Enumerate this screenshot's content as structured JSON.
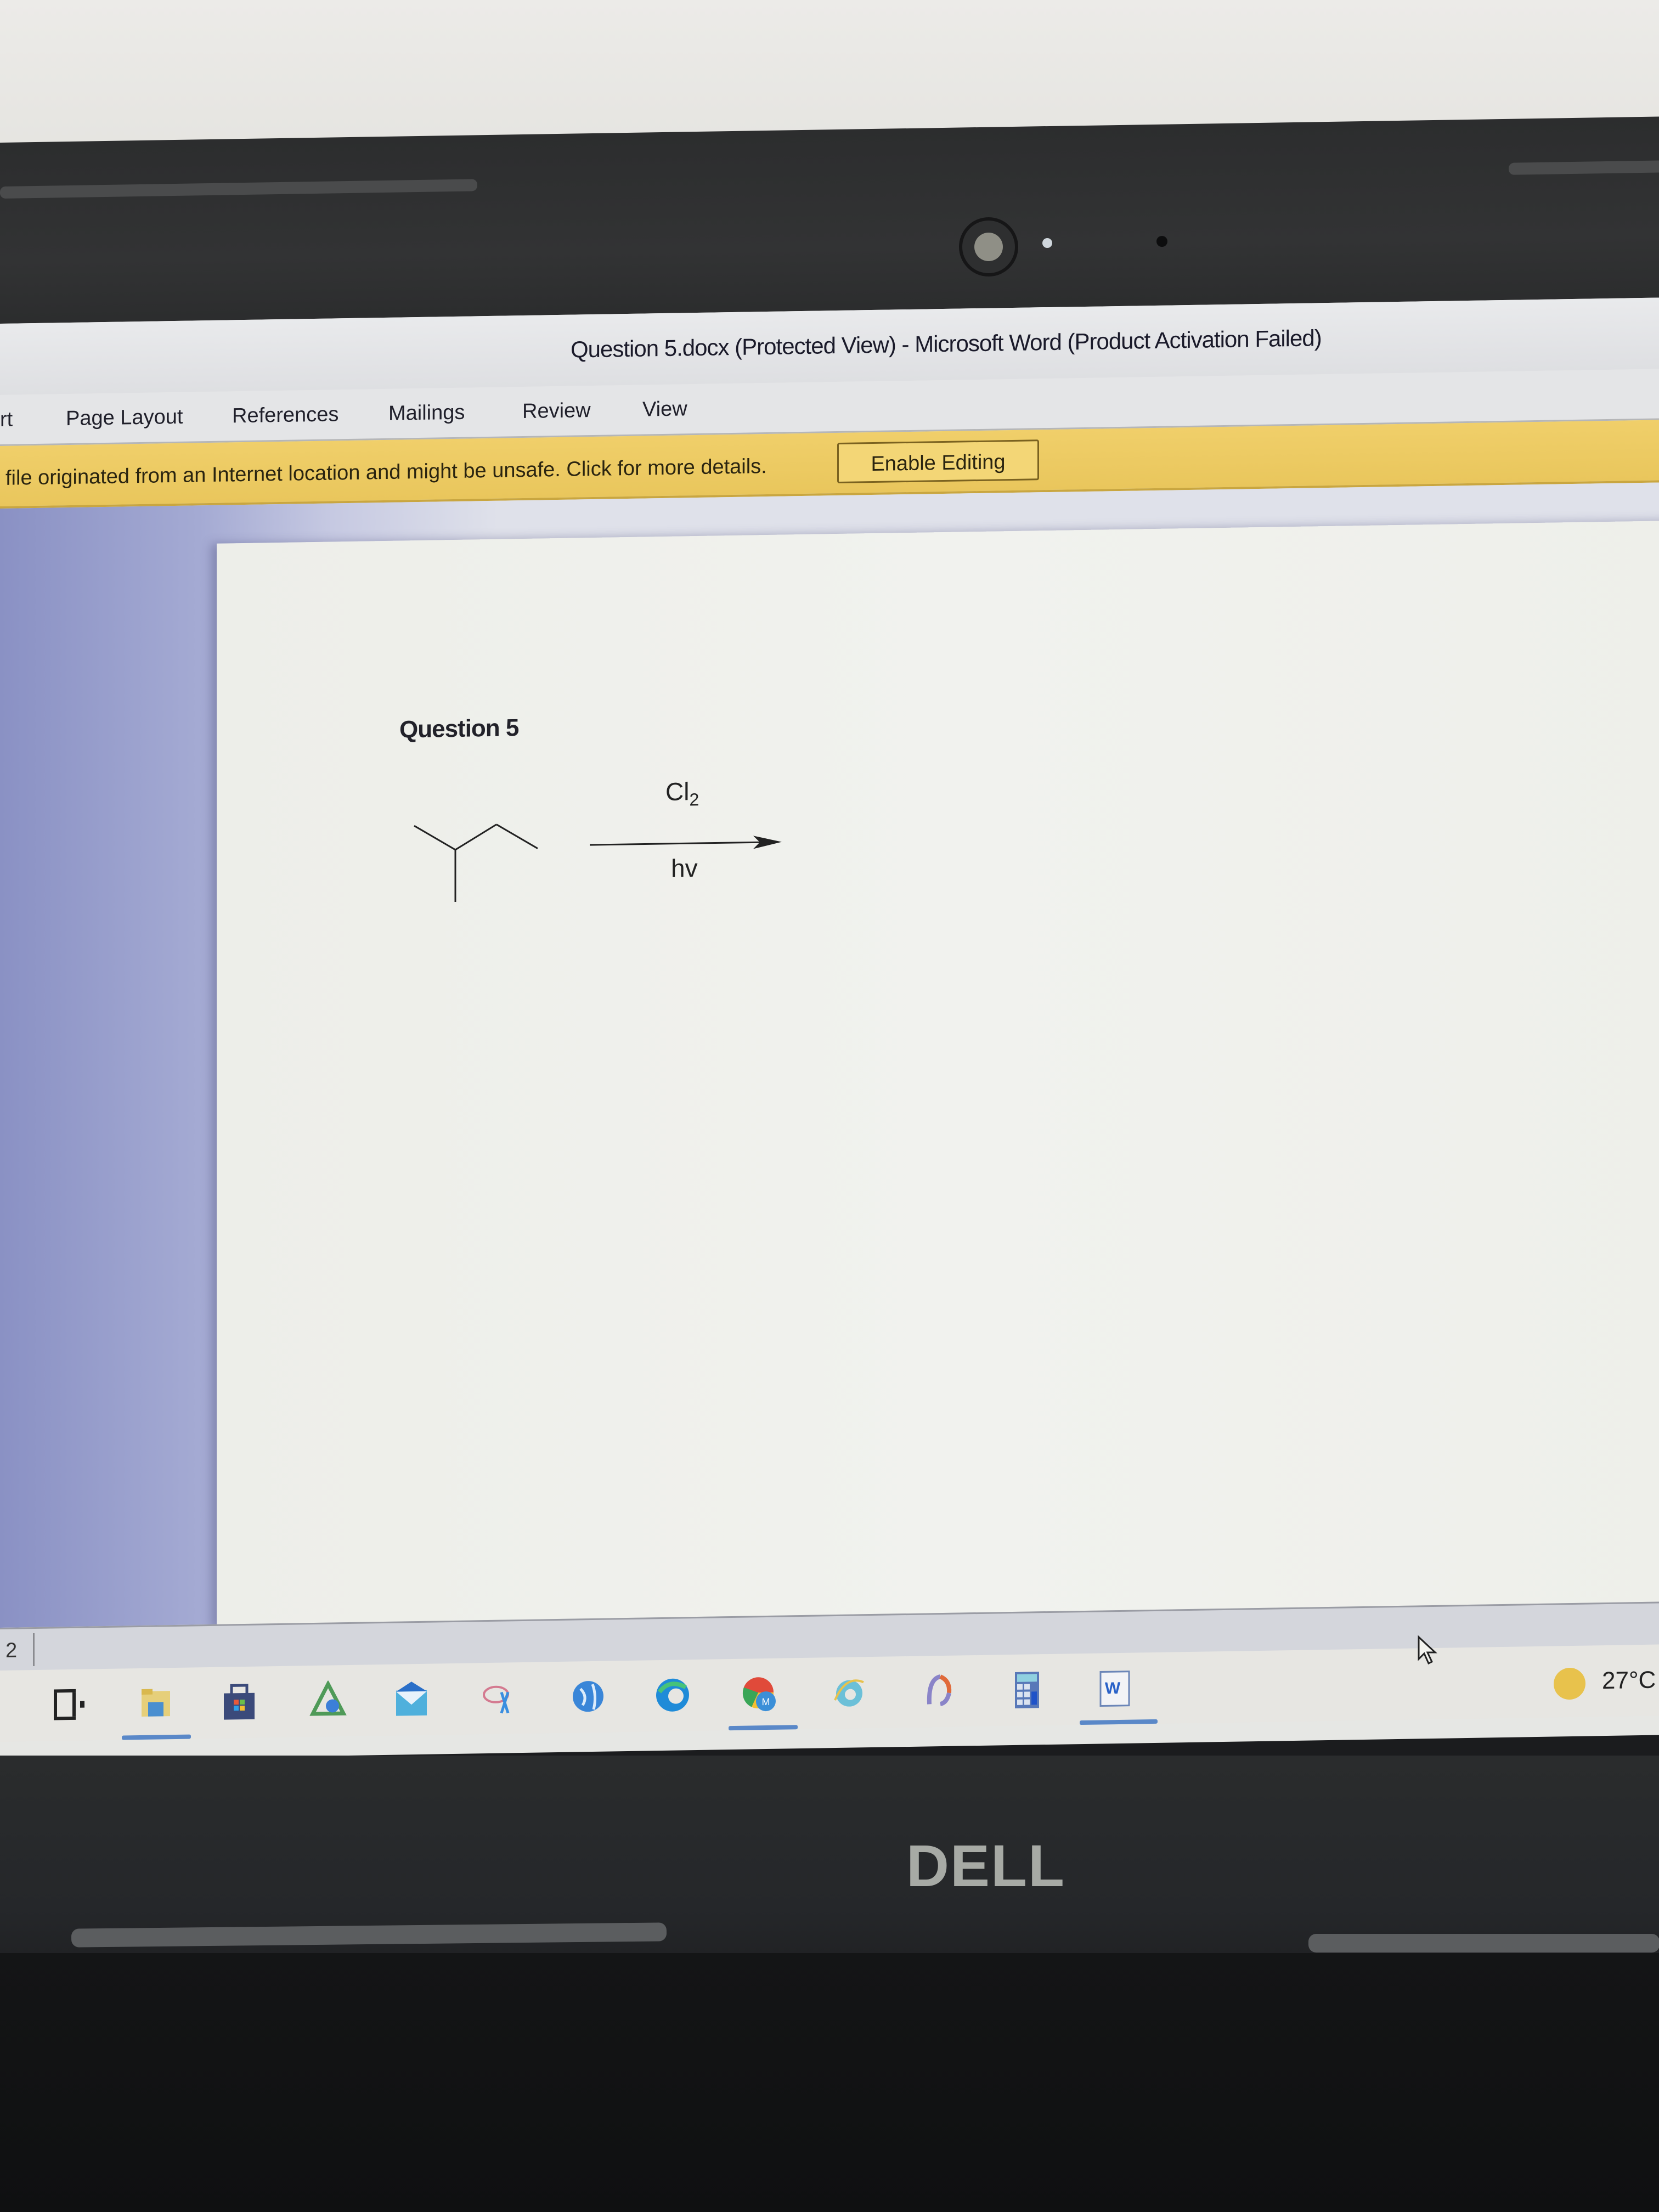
{
  "window": {
    "title": "Question 5.docx (Protected View)  -  Microsoft Word (Product Activation Failed)"
  },
  "ribbon": {
    "tabs": [
      {
        "label": "rt"
      },
      {
        "label": "Page Layout"
      },
      {
        "label": "References"
      },
      {
        "label": "Mailings"
      },
      {
        "label": "Review"
      },
      {
        "label": "View"
      }
    ]
  },
  "protected_view_bar": {
    "message": "file originated from an Internet location and might be unsafe. Click for more details.",
    "button_label": "Enable Editing",
    "color": "#eccb62"
  },
  "document": {
    "heading": "Question 5",
    "reaction": {
      "reagent_above": "Cl",
      "reagent_above_subscript": "2",
      "reagent_below": "hv",
      "reactant": "2-methylbutane (skeletal structure)"
    }
  },
  "statusbar": {
    "page_fragment": "2"
  },
  "taskbar": {
    "icons": [
      {
        "name": "task-view-icon"
      },
      {
        "name": "file-explorer-icon",
        "active": true
      },
      {
        "name": "microsoft-store-icon"
      },
      {
        "name": "photos-app-icon"
      },
      {
        "name": "mail-icon"
      },
      {
        "name": "snipping-tool-icon"
      },
      {
        "name": "globe-browser-icon"
      },
      {
        "name": "microsoft-edge-icon"
      },
      {
        "name": "chrome-profile-icon",
        "active": true,
        "badge": "M"
      },
      {
        "name": "internet-explorer-icon"
      },
      {
        "name": "app-arc-icon"
      },
      {
        "name": "calculator-icon"
      },
      {
        "name": "microsoft-word-icon",
        "active": true,
        "badge": "W"
      }
    ],
    "weather": {
      "temperature": "27°C"
    }
  },
  "hardware": {
    "brand": "DELL"
  }
}
